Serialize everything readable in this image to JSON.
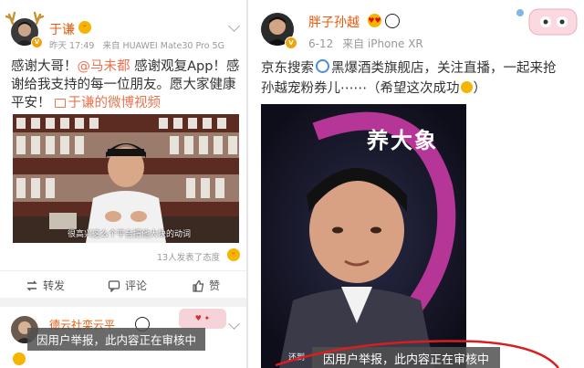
{
  "left_post": {
    "author": "于谦",
    "time": "昨天 17:49",
    "source": "来自 HUAWEI Mate30 Pro 5G",
    "text_line1": "感谢大哥！",
    "mention": "@马未都",
    "text_line1_rest": " 感谢观复App！感",
    "text_line2": "谢给我支持的每一位朋友。愿大家健康",
    "text_line3": "平安！",
    "video_link": "于谦的微博视频",
    "video_caption": "很高兴这么个平台把他大块的动词",
    "attitude": "13人发表了态度",
    "actions": {
      "repost": "转发",
      "comment": "评论",
      "like": "赞"
    }
  },
  "left_post2": {
    "author": "德云社栾云平",
    "review_notice": "因用户举报，此内容正在审核中"
  },
  "right_post": {
    "author": "胖子孙越",
    "time": "6-12",
    "source": "来自 iPhone XR",
    "text_line1a": "京东搜索",
    "text_line1b": "黑爆酒类旗舰店，关注直播，一起来抢",
    "text_line2": "孙越宠粉券儿⋯⋯（希望这次成功",
    "text_line2_end": "）",
    "poster_text": "养大象",
    "poster_corner": "还到",
    "review_notice": "因用户举报，此内容正在审核中"
  },
  "colors": {
    "accent": "#e8590c",
    "link": "#eb7350",
    "poster_bg": "#17172a",
    "ribbon": "#c83aa4"
  },
  "icons": [
    "v-verified-badge",
    "dropdown-chevron-icon",
    "video-link-icon",
    "laugh-emoji-icon",
    "repost-icon",
    "comment-icon",
    "like-icon",
    "search-emoji-icon",
    "panda-emoji-icon"
  ]
}
